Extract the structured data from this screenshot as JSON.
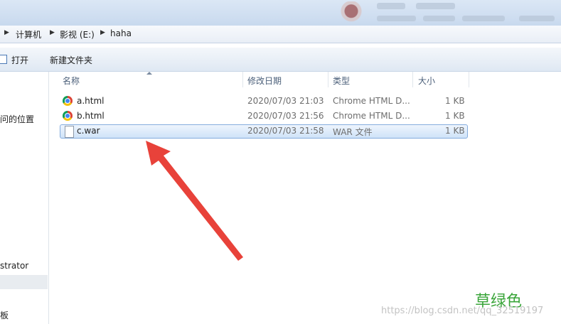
{
  "address": {
    "crumbs": [
      "计算机",
      "影视 (E:)",
      "haha"
    ]
  },
  "toolbar": {
    "open_label": "打开",
    "new_folder_label": "新建文件夹"
  },
  "nav": {
    "items": [
      "问的位置",
      "strator",
      "板"
    ]
  },
  "columns": {
    "name": "名称",
    "modified": "修改日期",
    "type": "类型",
    "size": "大小"
  },
  "files": [
    {
      "name": "a.html",
      "modified": "2020/07/03 21:03",
      "type": "Chrome HTML D...",
      "size": "1 KB",
      "icon": "chrome-icon"
    },
    {
      "name": "b.html",
      "modified": "2020/07/03 21:56",
      "type": "Chrome HTML D...",
      "size": "1 KB",
      "icon": "chrome-icon"
    },
    {
      "name": "c.war",
      "modified": "2020/07/03 21:58",
      "type": "WAR 文件",
      "size": "1 KB",
      "icon": "file-icon",
      "selected": true
    }
  ],
  "overlay": {
    "brand": "草绿色",
    "watermark": "https://blog.csdn.net/qq_32519197",
    "arrow_color": "#e8423a"
  }
}
